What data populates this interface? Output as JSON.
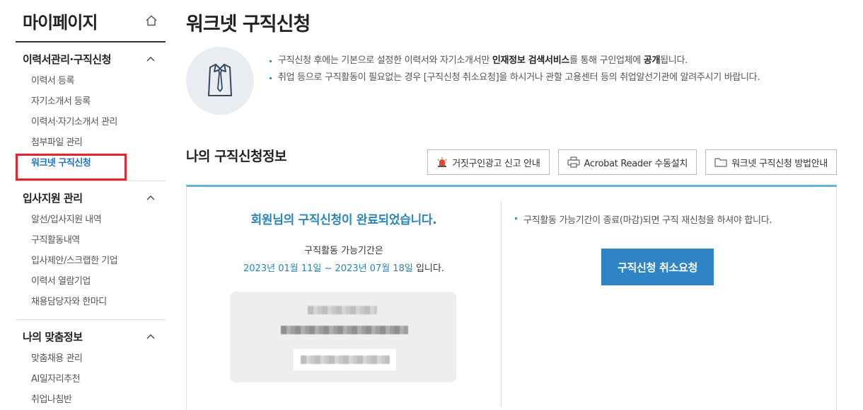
{
  "sidebar": {
    "title": "마이페이지",
    "groups": [
      {
        "title": "이력서관리·구직신청",
        "items": [
          {
            "label": "이력서 등록"
          },
          {
            "label": "자기소개서 등록"
          },
          {
            "label": "이력서·자기소개서 관리"
          },
          {
            "label": "첨부파일 관리"
          },
          {
            "label": "워크넷 구직신청"
          }
        ]
      },
      {
        "title": "입사지원 관리",
        "items": [
          {
            "label": "알선/입사지원 내역"
          },
          {
            "label": "구직활동내역"
          },
          {
            "label": "입사제안/스크랩한 기업"
          },
          {
            "label": "이력서 열람기업"
          },
          {
            "label": "채용담당자와 한마디"
          }
        ]
      },
      {
        "title": "나의 맞춤정보",
        "items": [
          {
            "label": "맞춤채용 관리"
          },
          {
            "label": "AI일자리추천"
          },
          {
            "label": "취업나침반"
          }
        ]
      }
    ]
  },
  "main": {
    "title": "워크넷 구직신청",
    "intro": {
      "line1_pre": "구직신청 후에는 기본으로 설정한 이력서와 자기소개서만 ",
      "line1_bold1": "인재정보 검색서비스",
      "line1_mid": "를 통해 구인업체에 ",
      "line1_bold2": "공개",
      "line1_post": "됩니다.",
      "line2": "취업 등으로 구직활동이 필요없는 경우 [구직신청 취소요청]을 하시거나 관할 고용센터 등의 취업알선기관에 알려주시기 바랍니다."
    },
    "section_title": "나의 구직신청정보",
    "buttons": {
      "report": "거짓구인광고 신고 안내",
      "acrobat": "Acrobat Reader 수동설치",
      "guide": "워크넷 구직신청 방법안내"
    },
    "status": {
      "done_message": "회원님의 구직신청이 완료되었습니다.",
      "period_label": "구직활동 가능기간은",
      "period_range": "2023년 01월 11일 ~ 2023년 07월 18일",
      "period_suffix": " 입니다."
    },
    "notice": "구직활동 가능기간이 종료(마감)되면 구직 재신청을 하셔야 합니다.",
    "cancel_button": "구직신청 취소요청"
  },
  "colors": {
    "accent_blue": "#2f84c5",
    "highlight_red": "#e8232b",
    "panel_top_border": "#5fb8d1"
  }
}
